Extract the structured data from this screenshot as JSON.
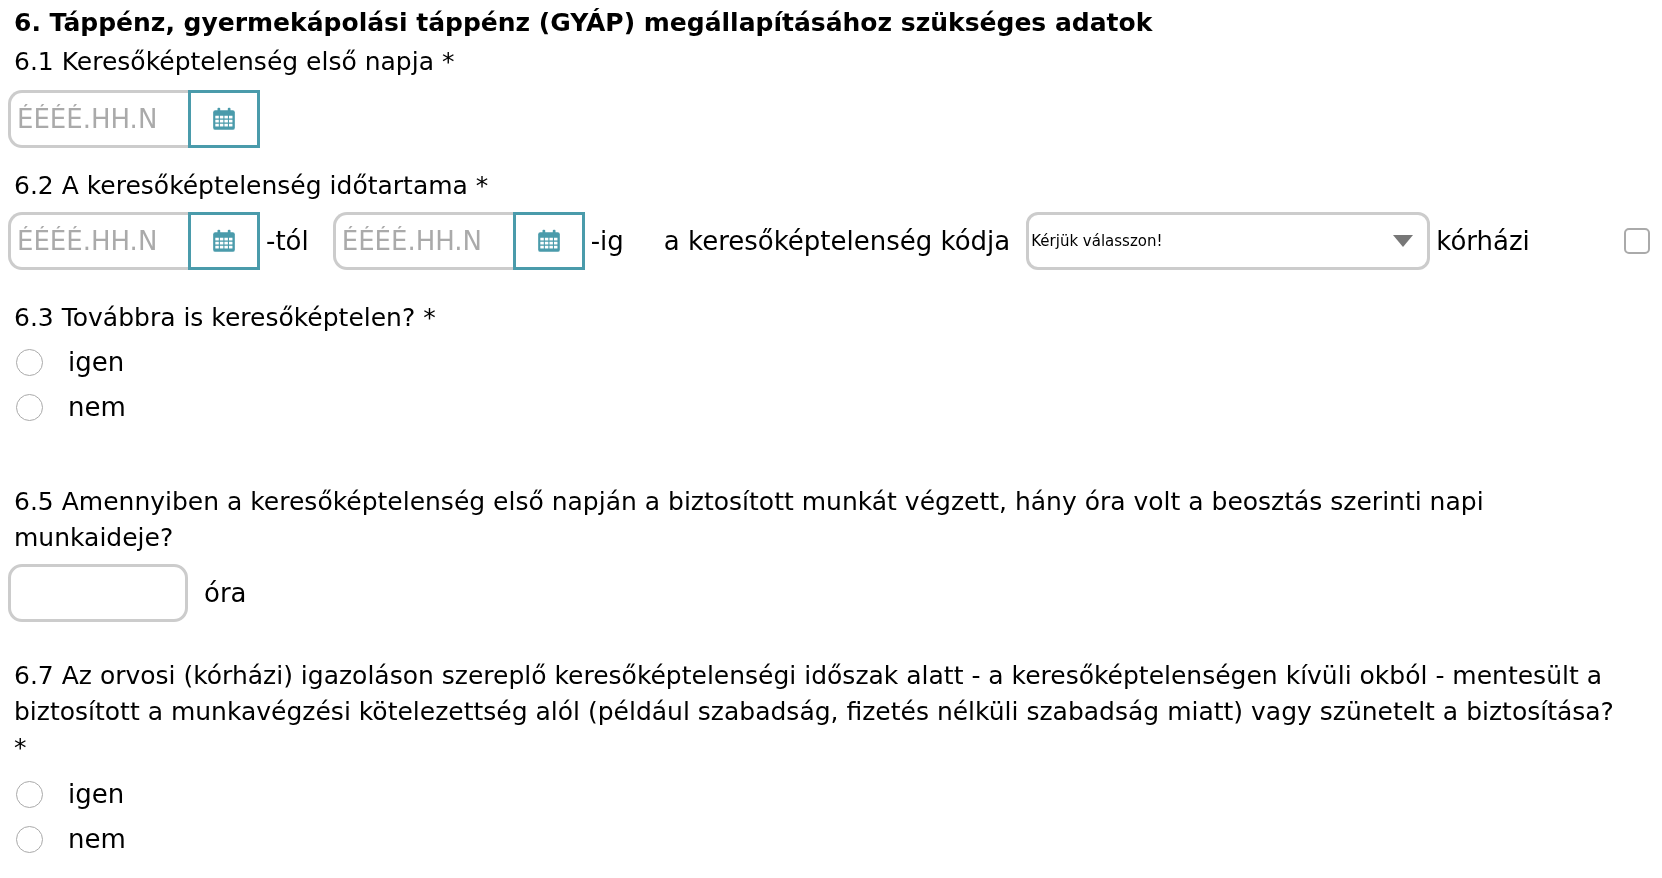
{
  "heading": "6. Táppénz, gyermekápolási táppénz (GYÁP) megállapításához szükséges adatok",
  "q6_1": {
    "label": "6.1 Keresőképtelenség első napja *",
    "date": {
      "placeholder": "ÉÉÉÉ.HH.N"
    }
  },
  "q6_2": {
    "label": "6.2 A keresőképtelenség időtartama *",
    "from": {
      "placeholder": "ÉÉÉÉ.HH.N"
    },
    "from_suffix": "-tól",
    "to": {
      "placeholder": "ÉÉÉÉ.HH.N"
    },
    "to_suffix": "-ig",
    "code_label": "a keresőképtelenség kódja",
    "code_select": "Kérjük válasszon!",
    "hospital_label": "kórházi",
    "hospital_checked": false
  },
  "q6_3": {
    "label": "6.3 Továbbra is keresőképtelen? *",
    "options": [
      {
        "label": "igen",
        "selected": false
      },
      {
        "label": "nem",
        "selected": false
      }
    ]
  },
  "q6_5": {
    "label": "6.5 Amennyiben a keresőképtelenség első napján a biztosított munkát végzett, hány óra volt a beosztás szerinti napi munkaideje?",
    "unit": "óra"
  },
  "q6_7": {
    "label": "6.7 Az orvosi (kórházi) igazoláson szereplő keresőképtelenségi időszak alatt - a keresőképtelenségen kívüli okból - mentesült a biztosított a munkavégzési kötelezettség alól (például szabadság, fizetés nélküli szabadság miatt) vagy szünetelt a biztosítása? *",
    "options": [
      {
        "label": "igen",
        "selected": false
      },
      {
        "label": "nem",
        "selected": false
      }
    ]
  }
}
